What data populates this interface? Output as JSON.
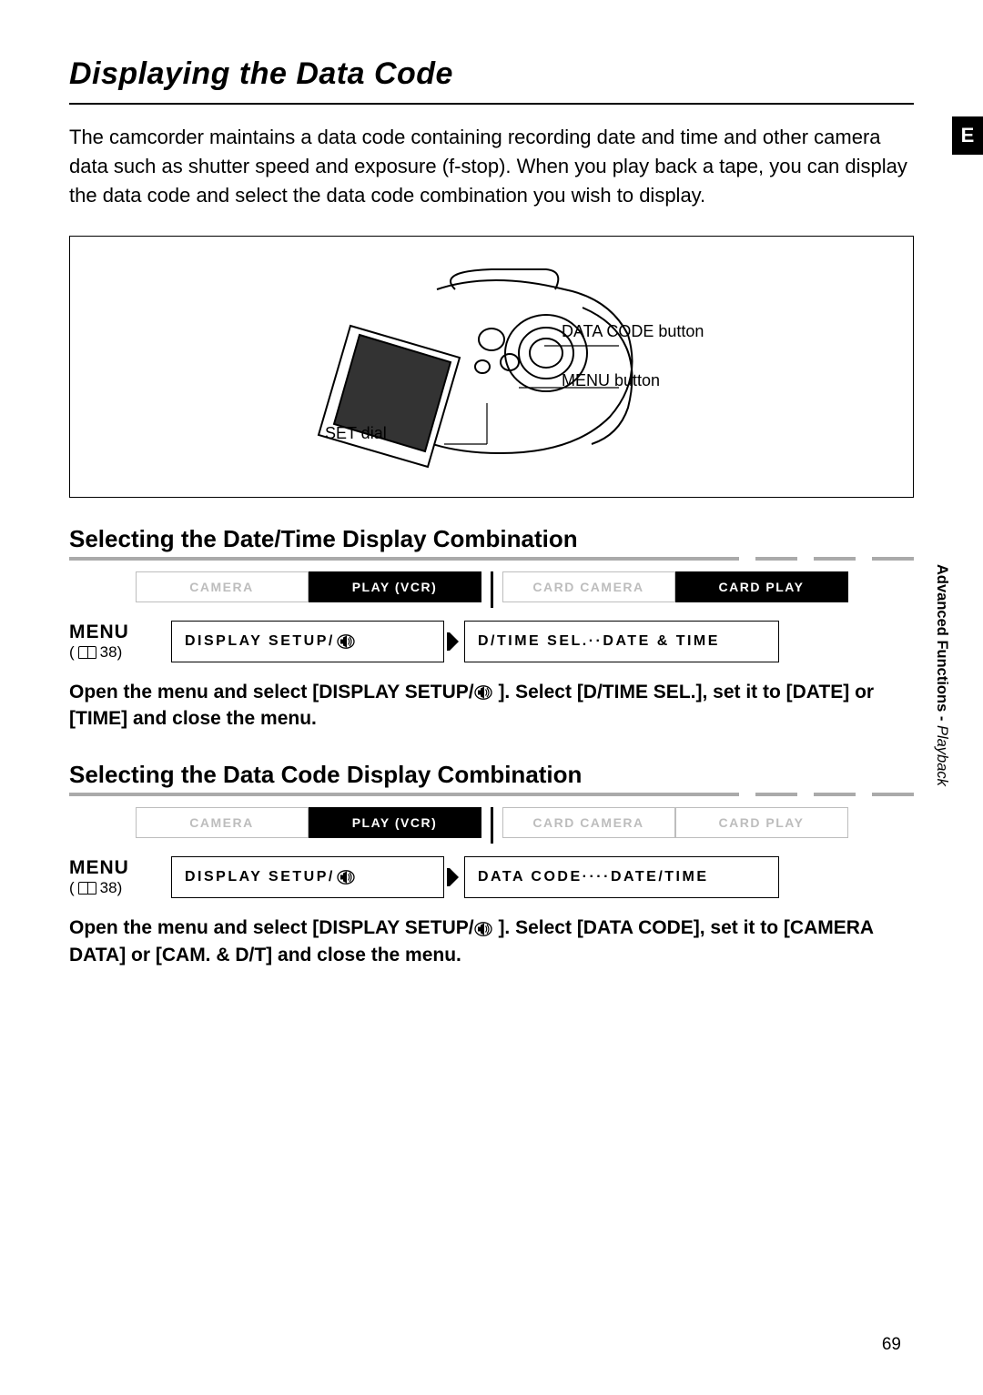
{
  "page_title": "Displaying the Data Code",
  "intro": "The camcorder maintains a data code containing recording date and time and other camera data such as shutter speed and exposure (f-stop). When you play back a tape, you can display the data code and select the data code combination you wish to display.",
  "figure": {
    "label_datacode": "DATA CODE button",
    "label_menu": "MENU button",
    "label_setdial": "SET dial"
  },
  "right_tab": "E",
  "side": {
    "bold": "Advanced Functions - ",
    "italic": "Playback"
  },
  "page_number": "69",
  "sections": [
    {
      "heading": "Selecting the Date/Time Display Combination",
      "modes": [
        {
          "label": "CAMERA",
          "state": "inactive"
        },
        {
          "label": "PLAY (VCR)",
          "state": "active"
        },
        {
          "label": "CARD CAMERA",
          "state": "inactive"
        },
        {
          "label": "CARD PLAY",
          "state": "active"
        }
      ],
      "menu_label": "MENU",
      "menu_ref": "38",
      "menu_left": "DISPLAY SETUP/",
      "menu_right": "D/TIME SEL.··DATE & TIME",
      "instruction_pre": "Open the menu and select [DISPLAY SETUP/",
      "instruction_post": " ]. Select [D/TIME SEL.], set it to [DATE] or [TIME] and close the menu."
    },
    {
      "heading": "Selecting the Data Code Display Combination",
      "modes": [
        {
          "label": "CAMERA",
          "state": "inactive"
        },
        {
          "label": "PLAY (VCR)",
          "state": "active"
        },
        {
          "label": "CARD CAMERA",
          "state": "inactive"
        },
        {
          "label": "CARD PLAY",
          "state": "inactive"
        }
      ],
      "menu_label": "MENU",
      "menu_ref": "38",
      "menu_left": "DISPLAY SETUP/",
      "menu_right": "DATA CODE····DATE/TIME",
      "instruction_pre": "Open the menu and select [DISPLAY SETUP/",
      "instruction_post": " ]. Select [DATA CODE], set it to [CAMERA DATA] or [CAM. & D/T] and close the menu."
    }
  ]
}
